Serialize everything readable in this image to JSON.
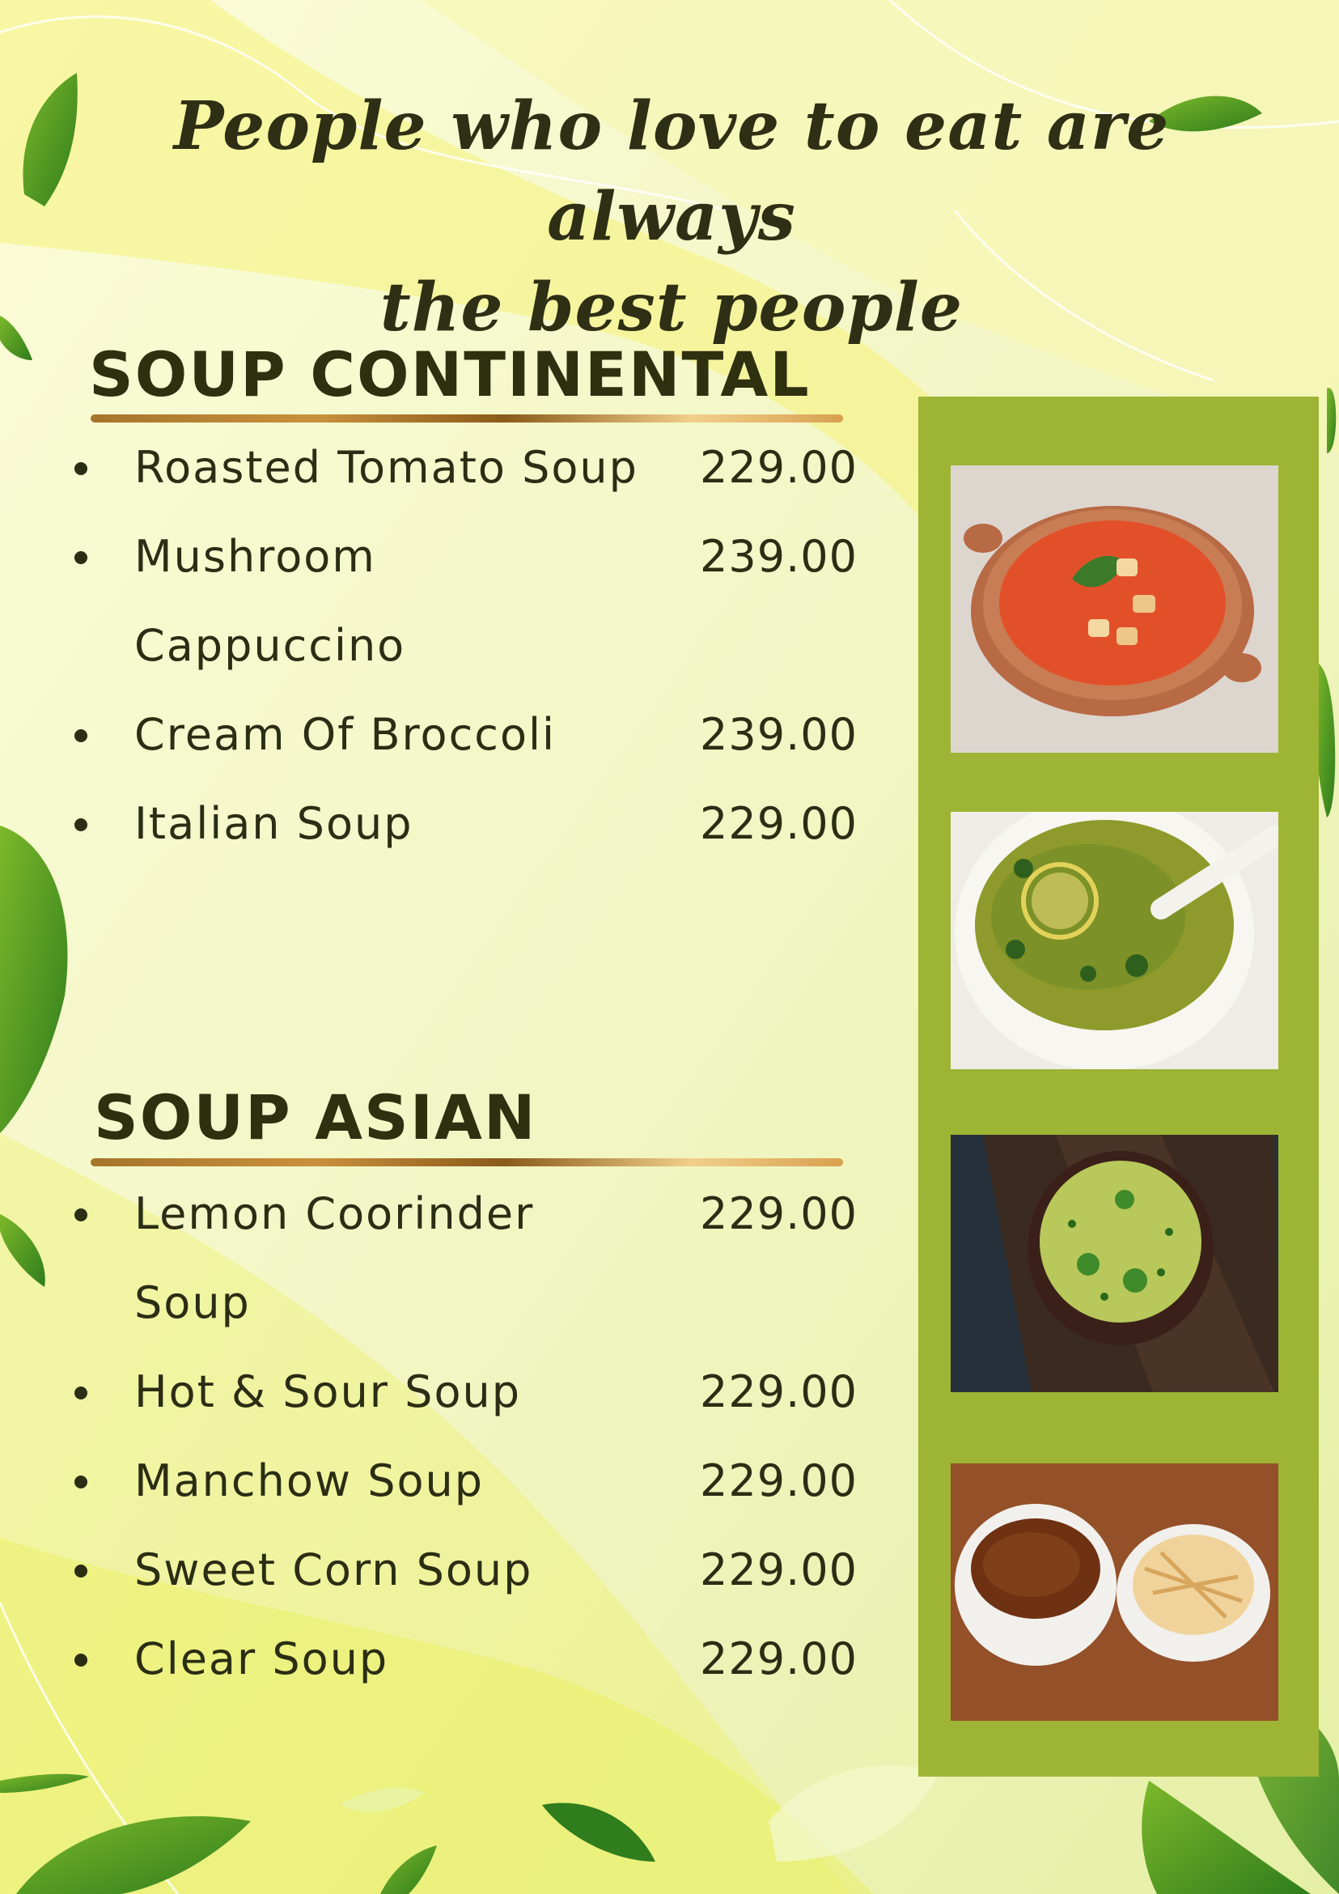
{
  "tagline": {
    "line1": "People who love to eat are always",
    "line2": "the best people"
  },
  "sections": [
    {
      "title": "SOUP CONTINENTAL",
      "items": [
        {
          "name": "Roasted Tomato Soup",
          "price": "229.00"
        },
        {
          "name": "Mushroom Cappuccino",
          "price": "239.00"
        },
        {
          "name": "Cream Of Broccoli",
          "price": "239.00"
        },
        {
          "name": "Italian Soup",
          "price": "229.00"
        }
      ]
    },
    {
      "title": "SOUP ASIAN",
      "items": [
        {
          "name": "Lemon Coorinder Soup",
          "price": "229.00"
        },
        {
          "name": "Hot & Sour Soup",
          "price": "229.00"
        },
        {
          "name": "Manchow Soup",
          "price": "229.00"
        },
        {
          "name": "Sweet Corn Soup",
          "price": "229.00"
        },
        {
          "name": "Clear Soup",
          "price": "229.00"
        }
      ]
    }
  ],
  "colors": {
    "background": "#f3f6c8",
    "panel": "#9db434",
    "text": "#2b2d14",
    "rule_gold": "#c9913e"
  },
  "photos": [
    "tomato-soup-photo",
    "lemon-coriander-soup-photo",
    "broccoli-soup-photo",
    "manchow-soup-photo"
  ]
}
